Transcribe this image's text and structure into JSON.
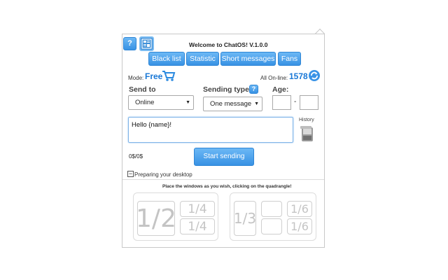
{
  "header": {
    "help_label": "?",
    "title": "Welcome to ChatOS! V.1.0.0"
  },
  "tabs": [
    {
      "label": "Black list"
    },
    {
      "label": "Statistic"
    },
    {
      "label": "Short messages"
    },
    {
      "label": "Fans"
    }
  ],
  "status": {
    "mode_label": "Mode:",
    "mode_value": "Free",
    "online_label": "All On-line:",
    "online_count": "1578"
  },
  "form": {
    "send_to_label": "Send to",
    "send_to_value": "Online",
    "sending_type_label": "Sending type",
    "sending_type_help": "?",
    "sending_type_value": "One message",
    "age_label": "Age:",
    "age_separator": "-",
    "message_value": "Hello {name}!",
    "history_label": "History",
    "progress_text": "0$/0$",
    "start_button": "Start sending"
  },
  "desktop": {
    "toggle_symbol": "−",
    "label": "Preparing your desktop",
    "instruction": "Place the windows as you wish, clicking on the quadrangle!",
    "layout_halves": "1/2",
    "layout_quarter_top": "1/4",
    "layout_quarter_bottom": "1/4",
    "layout_third": "1/3",
    "layout_sixth_top": "1/6",
    "layout_sixth_bottom": "1/6"
  },
  "colors": {
    "accent": "#3892e4",
    "free_text": "#1a78d6",
    "count_text": "#1a78d6"
  }
}
